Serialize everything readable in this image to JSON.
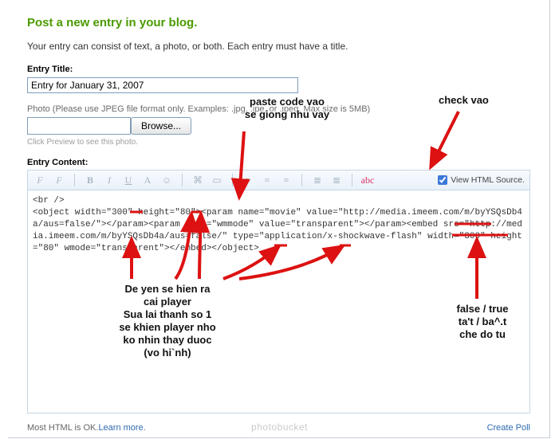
{
  "header": {
    "title": "Post a new entry in your blog.",
    "intro": "Your entry can consist of text, a photo, or both. Each entry must have a title."
  },
  "entry_title": {
    "label": "Entry Title:",
    "value": "Entry for January 31, 2007"
  },
  "photo": {
    "label": "Photo (Please use JPEG file format only. Examples: .jpg, .jpe, or .jpeg. Max size is 5MB)",
    "browse": "Browse...",
    "preview_note": "Click Preview to see this photo."
  },
  "entry_content": {
    "label": "Entry Content:",
    "toolbar": {
      "view_source_label": "View HTML Source.",
      "view_source_checked": true
    },
    "code": "<br />\n<object width=\"300\" height=\"80\"><param name=\"movie\" value=\"http://media.imeem.com/m/byYSQsDb4a/aus=false/\"></param><param name=\"wmmode\" value=\"transparent\"></param><embed src=\"http://media.imeem.com/m/byYSQsDb4a/aus=false/\" type=\"application/x-shockwave-flash\" width=\"300\" height=\"80\" wmode=\"transparent\"></embed></object>"
  },
  "footer": {
    "html_note_prefix": "Most HTML is OK.",
    "learn_more": "Learn more",
    "create_poll": "Create Poll"
  },
  "annotations": {
    "paste_code": "paste code vao\nse giong nhu vay",
    "check_vao": "check vao",
    "player_note": "De yen se hien ra\ncai player\nSua lai thanh so 1\nse khien player nho\nko nhin thay duoc\n(vo hi`nh)",
    "false_true": "false / true\nta't / ba^.t\nche do tu"
  },
  "watermark": "photobucket"
}
